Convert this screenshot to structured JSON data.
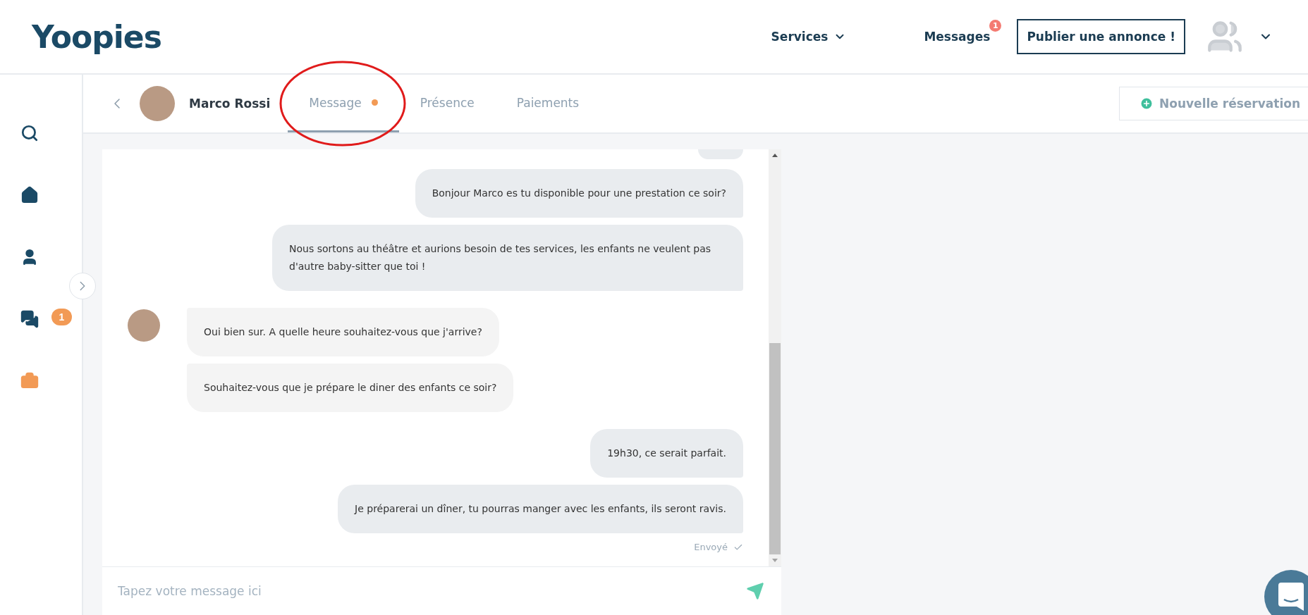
{
  "header": {
    "logo": "Yoopies",
    "nav": [
      {
        "label": "Services",
        "kind": "dropdown"
      },
      {
        "label": "Messages",
        "kind": "badge",
        "badge": "1"
      }
    ],
    "publish_button": "Publier une annonce !"
  },
  "sidebar": {
    "items": [
      {
        "selected": false
      },
      {
        "selected": false
      },
      {
        "selected": false
      },
      {
        "selected": false,
        "badge": "1"
      },
      {
        "selected": true
      }
    ]
  },
  "contact": {
    "name": "Marco Rossi"
  },
  "tabs": [
    {
      "label": "Message",
      "selected": true,
      "unread": true
    },
    {
      "label": "Présence",
      "selected": false,
      "unread": false
    },
    {
      "label": "Paiements",
      "selected": false,
      "unread": false
    }
  ],
  "new_booking_button": "Nouvelle réservation",
  "messages": [
    {
      "kind": "sent",
      "text": "Bonjour Marco es tu disponible pour une prestation ce soir?"
    },
    {
      "kind": "sent",
      "text": "Nous sortons au théâtre et aurions besoin de tes services, les enfants ne veulent pas d'autre baby-sitter que toi !"
    },
    {
      "kind": "received",
      "text": "Oui bien sur. A quelle heure souhaitez-vous que j'arrive?",
      "show_avatar": true
    },
    {
      "kind": "received",
      "text": "Souhaitez-vous que je prépare le diner des enfants ce soir?",
      "show_avatar": false
    },
    {
      "kind": "sent",
      "text": "19h30, ce serait parfait."
    },
    {
      "kind": "sent",
      "text": "Je préparerai un dîner, tu pourras manger avec les enfants, ils seront ravis."
    }
  ],
  "delivery_status": "Envoyé",
  "composer": {
    "placeholder": "Tapez votre message ici"
  }
}
